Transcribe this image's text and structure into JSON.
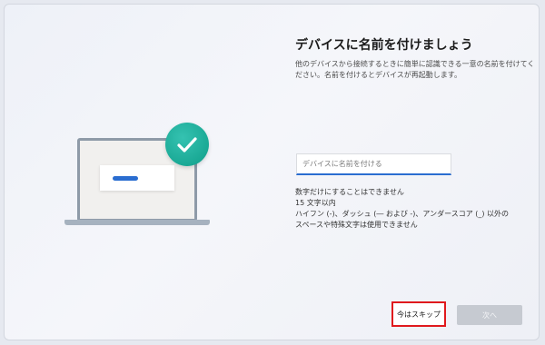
{
  "page": {
    "title": "デバイスに名前を付けましょう",
    "description": "他のデバイスから接続するときに簡単に認識できる一意の名前を付けてください。名前を付けるとデバイスが再起動します。"
  },
  "illustration": {
    "laptop_icon": "laptop-icon",
    "check_icon": "checkmark-icon",
    "accent_color": "#1aa995"
  },
  "name_field": {
    "value": "",
    "placeholder": "デバイスに名前を付ける"
  },
  "rules": [
    "数字だけにすることはできません",
    "15 文字以内",
    "ハイフン (-)、ダッシュ (― および -)、アンダースコア (_) 以外の",
    "スペースや特殊文字は使用できません"
  ],
  "buttons": {
    "skip_label": "今はスキップ",
    "next_label": "次へ"
  },
  "colors": {
    "accent": "#2a6dd0",
    "highlight_box": "#e0191d",
    "disabled_button": "#c6cad1"
  }
}
